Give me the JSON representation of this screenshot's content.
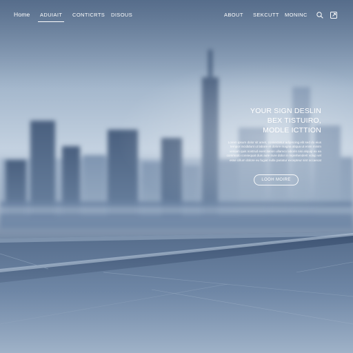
{
  "nav": {
    "items": [
      {
        "label": "Home"
      },
      {
        "label": "ADUIAIT"
      },
      {
        "label": "CONTICRTS"
      },
      {
        "label": "DISOUS"
      },
      {
        "label": "ABOUT"
      },
      {
        "label": "SEKCUTT"
      },
      {
        "label": "MONINC"
      }
    ],
    "active_index": 1,
    "search_icon": "search-icon",
    "share_icon": "external-link-icon"
  },
  "hero": {
    "title_lines": [
      "YOUR SIGN DESLIN",
      "BEX TISTUIRO,",
      "MODLE ICTTION"
    ],
    "body_lines": [
      "Lorem ipsum dolor sit amet, consectetur adipiscing elit sed do eius",
      "tempor incididunt ut labore et dolore magna aliqua ut enim minim",
      "veniam quis nostrud exercitation ullamco laboris nisi aliquip ex ea",
      "commodo consequat duis aute irure dolor in reprehenderit volup vel",
      "esse cillum dolore eu fugiat nulla pariatur excepteur sint occaecat"
    ],
    "cta_label": "LOOH MOIRE"
  },
  "colors": {
    "text": "#ffffff",
    "sky_top": "#6f87a5",
    "sky_mid": "#c3d1e0",
    "building": "#4f6583",
    "floor": "#5e7594"
  }
}
